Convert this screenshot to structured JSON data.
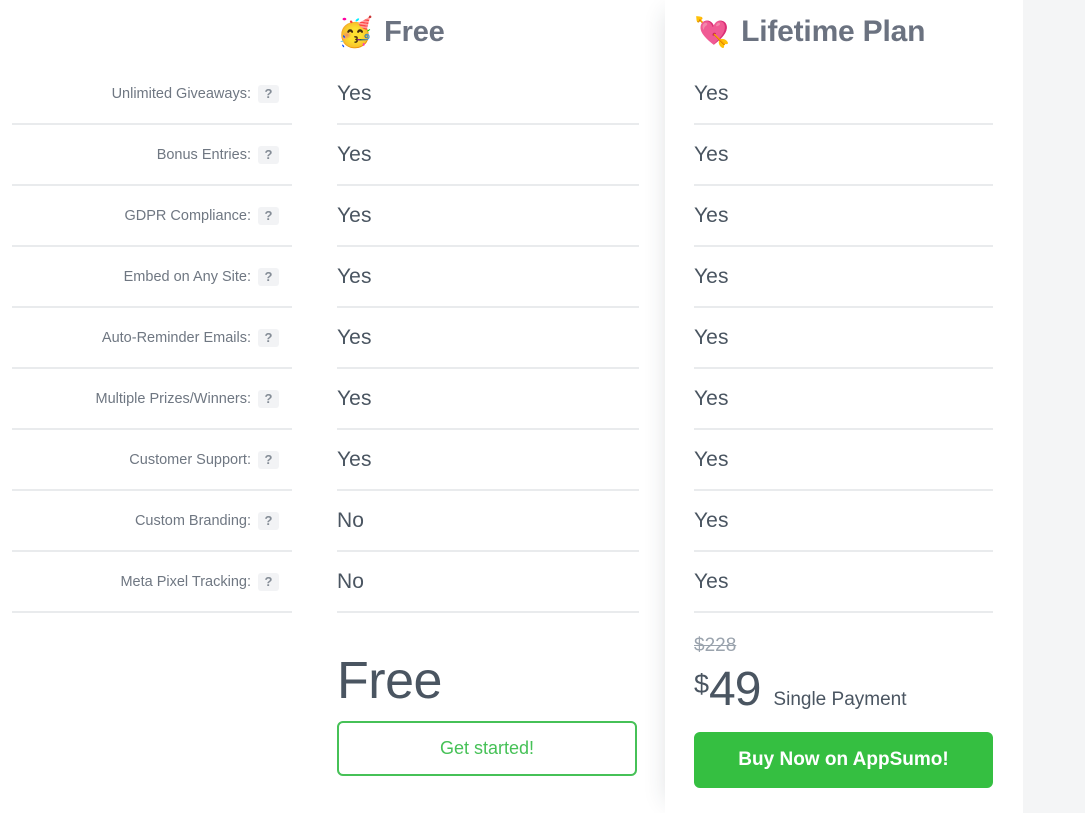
{
  "table": {
    "features": [
      {
        "label": "Unlimited Giveaways:",
        "help": "?"
      },
      {
        "label": "Bonus Entries:",
        "help": "?"
      },
      {
        "label": "GDPR Compliance:",
        "help": "?"
      },
      {
        "label": "Embed on Any Site:",
        "help": "?"
      },
      {
        "label": "Auto-Reminder Emails:",
        "help": "?"
      },
      {
        "label": "Multiple Prizes/Winners:",
        "help": "?"
      },
      {
        "label": "Customer Support:",
        "help": "?"
      },
      {
        "label": "Custom Branding:",
        "help": "?"
      },
      {
        "label": "Meta Pixel Tracking:",
        "help": "?"
      }
    ]
  },
  "plans": [
    {
      "id": "free",
      "emoji": "🥳",
      "emoji_name": "partying-face-emoji",
      "title": "Free",
      "values": [
        "Yes",
        "Yes",
        "Yes",
        "Yes",
        "Yes",
        "Yes",
        "Yes",
        "No",
        "No"
      ],
      "price": "Free",
      "cta_label": "Get started!",
      "cta_style": "outline",
      "accent_color": "#46c157"
    },
    {
      "id": "lifetime",
      "emoji": "💘",
      "emoji_name": "heart-with-arrow-emoji",
      "title": "Lifetime Plan",
      "values": [
        "Yes",
        "Yes",
        "Yes",
        "Yes",
        "Yes",
        "Yes",
        "Yes",
        "Yes",
        "Yes"
      ],
      "price_original": "$228",
      "price_currency": "$",
      "price_amount": "49",
      "price_note": "Single Payment",
      "cta_label": "Buy Now on AppSumo!",
      "cta_style": "solid",
      "accent_color": "#35bf41"
    }
  ],
  "colors": {
    "text_primary": "#4a5561",
    "text_muted": "#6f7782",
    "heading": "#6b7280",
    "divider": "#e9ebed",
    "strike": "#9aa3ad",
    "green_outline": "#46c157",
    "green_solid": "#35bf41",
    "panel_gutter": "#f4f5f6"
  }
}
